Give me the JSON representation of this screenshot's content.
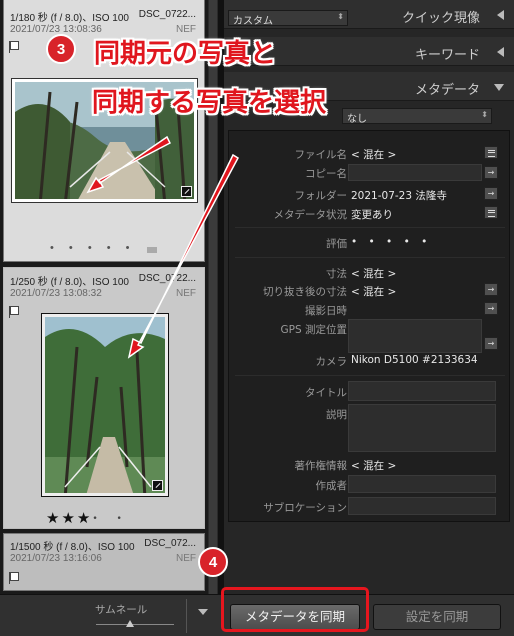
{
  "filmstrip": {
    "items": [
      {
        "exposure": "1/180 秒 (f / 8.0)、ISO 100",
        "filename": "DSC_0722...",
        "date": "2021/07/23 13:08:36",
        "ext": "NEF",
        "rating_dots": "• • • • •"
      },
      {
        "exposure": "1/250 秒 (f / 8.0)、ISO 100",
        "filename": "DSC_0722...",
        "date": "2021/07/23 13:08:32",
        "ext": "NEF",
        "stars": "★★★",
        "stars_off": "• •"
      },
      {
        "exposure": "1/1500 秒 (f / 8.0)、ISO 100",
        "filename": "DSC_072...",
        "date": "2021/07/23 13:16:06",
        "ext": "NEF"
      }
    ]
  },
  "panel": {
    "preset_value": "カスタム",
    "quick_develop": "クイック現像",
    "keywords": "キーワード",
    "metadata": "メタデータ",
    "metadata_preset": "なし",
    "fields": {
      "filename_label": "ファイル名",
      "filename_value": "< 混在 >",
      "copyname_label": "コピー名",
      "folder_label": "フォルダー",
      "folder_value": "2021-07-23  法隆寺",
      "status_label": "メタデータ状況",
      "status_value": "変更あり",
      "rating_label": "評価",
      "rating_value": "• • • • •",
      "dimensions_label": "寸法",
      "dimensions_value": "< 混在 >",
      "cropped_label": "切り抜き後の寸法",
      "cropped_value": "< 混在 >",
      "capture_label": "撮影日時",
      "gps_label": "GPS 測定位置",
      "camera_label": "カメラ",
      "camera_value": "Nikon D5100 #2133634",
      "title_label": "タイトル",
      "caption_label": "説明",
      "copyright_label": "著作権情報",
      "copyright_value": "< 混在 >",
      "creator_label": "作成者",
      "sublocation_label": "サブロケーション"
    }
  },
  "bottombar": {
    "thumbnail_label": "サムネール",
    "sync_metadata": "メタデータを同期",
    "sync_settings": "設定を同期"
  },
  "annotations": {
    "step3": "3",
    "step4": "4",
    "callout_line1": "同期元の写真と",
    "callout_line2": "同期する写真を選択",
    "color": "#e0161e"
  }
}
